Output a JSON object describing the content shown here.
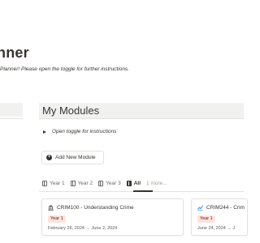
{
  "page": {
    "title": "nner",
    "intro": "Planner! Please open the toggle for further instructions."
  },
  "modules": {
    "heading": "My Modules",
    "toggle_label": "Open toggle for instructions",
    "add_button": "Add New Module",
    "tabs": [
      {
        "label": "Year 1",
        "active": false
      },
      {
        "label": "Year 2",
        "active": false
      },
      {
        "label": "Year 3",
        "active": false
      },
      {
        "label": "All",
        "active": true
      }
    ],
    "more_label": "1 more...",
    "cards": [
      {
        "icon": "bank-icon",
        "title": "CRIM100 - Understanding Crime",
        "badge": "Year 1",
        "dates": "February 26, 2024 → June 2, 2024"
      },
      {
        "icon": "trend-chart-icon",
        "title": "CRIM244 - Crim",
        "badge": "Year 1",
        "dates": "June 24, 2024 → J"
      }
    ]
  },
  "colors": {
    "header_bg": "#f1f1ef",
    "badge_bg": "#ffe2dd",
    "badge_text": "#5d1715",
    "text": "#37352f",
    "trend_icon": "#2383e2"
  }
}
